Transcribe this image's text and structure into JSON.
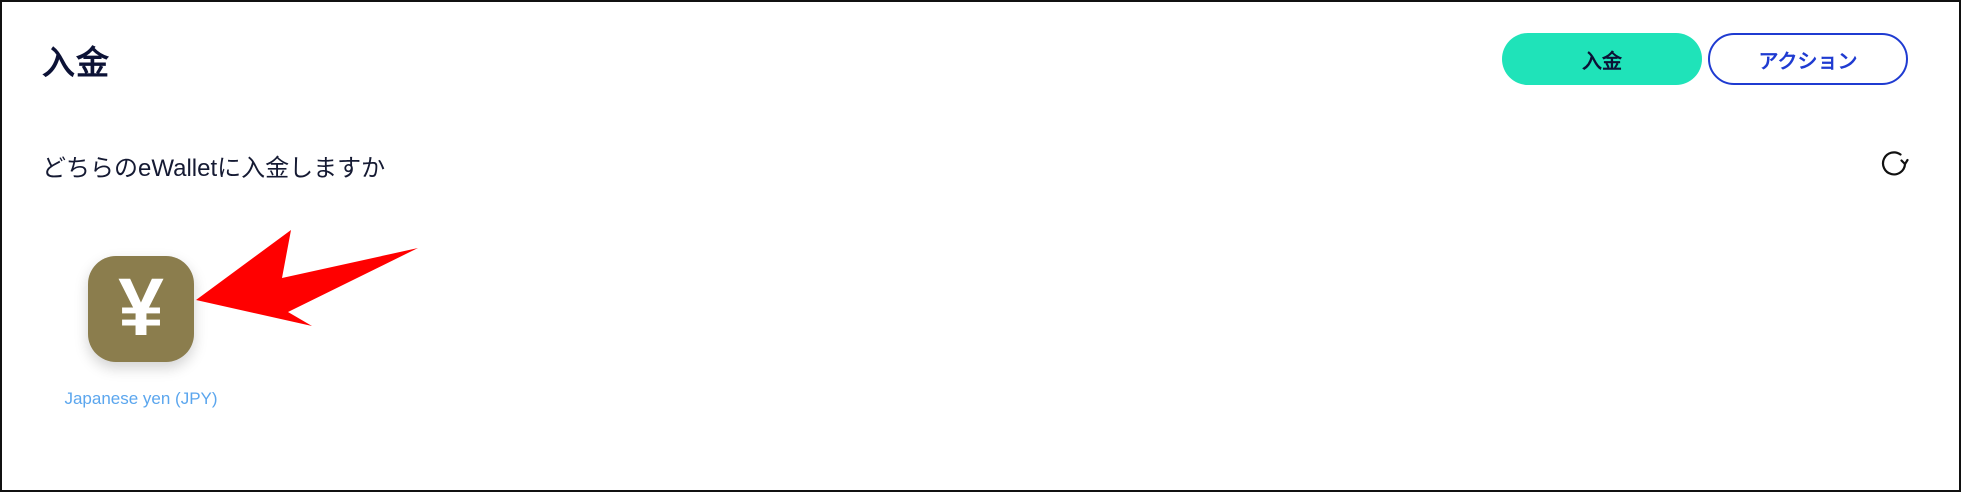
{
  "header": {
    "title": "入金",
    "deposit_button": "入金",
    "action_button": "アクション"
  },
  "wallet_picker": {
    "question": "どちらのeWalletに入金しますか",
    "refresh_icon": "refresh-icon",
    "wallets": [
      {
        "symbol": "¥",
        "icon": "yen-icon",
        "label": "Japanese yen (JPY)",
        "color": "#8b7d4d"
      }
    ]
  },
  "annotation": {
    "arrow_color": "#ff0000"
  },
  "colors": {
    "accent": "#1fe3b9",
    "primary": "#1f3bd1",
    "title": "#0c1236",
    "link": "#5ba6ee"
  }
}
